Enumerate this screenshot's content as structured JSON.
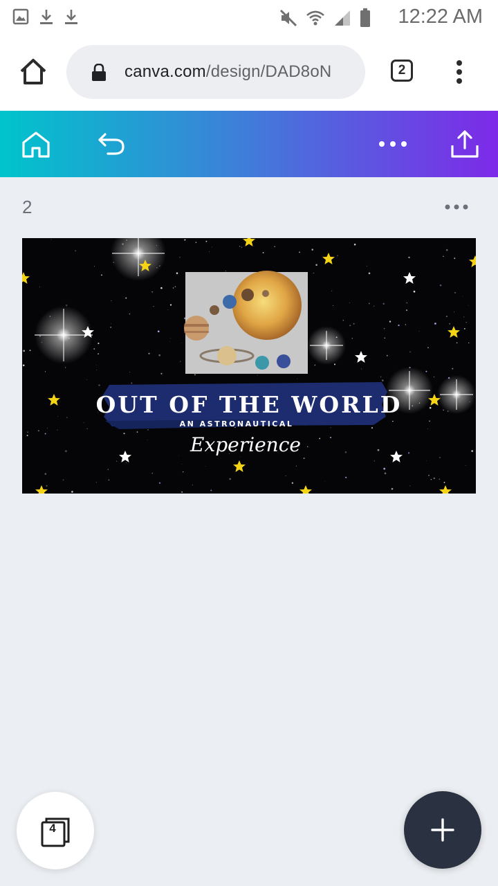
{
  "status_bar": {
    "time": "12:22 AM",
    "left_icons": [
      "image-icon",
      "download-icon",
      "download-icon"
    ],
    "right_icons": [
      "mute-icon",
      "wifi-icon",
      "signal-icon",
      "battery-icon"
    ]
  },
  "browser": {
    "url_domain": "canva.com",
    "url_path": "/design/DAD8oN",
    "tab_count": "2"
  },
  "toolbar": {
    "icons": [
      "home-icon",
      "undo-icon",
      "more-options-icon",
      "share-icon"
    ]
  },
  "page": {
    "number": "2"
  },
  "design": {
    "title": "OUT OF THE WORLD",
    "subtitle": "AN ASTRONAUTICAL",
    "script": "Experience"
  },
  "bottom": {
    "pages_count": "4"
  },
  "colors": {
    "header_gradient_start": "#00c4cc",
    "header_gradient_end": "#7d2ae8",
    "background": "#ebeef2",
    "fab": "#2a3140",
    "banner": "#1c2c6e"
  }
}
